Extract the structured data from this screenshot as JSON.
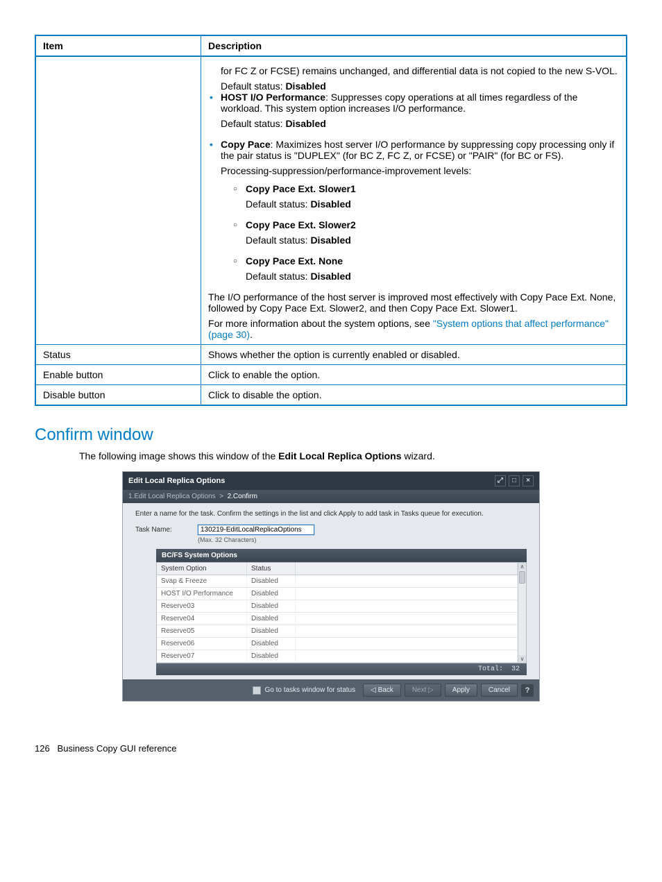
{
  "table": {
    "header_item": "Item",
    "header_desc": "Description",
    "row0": {
      "frag_a": "for FC Z or FCSE) remains unchanged, and differential data is not copied to the new S-VOL.",
      "frag_b_pre": "Default status: ",
      "frag_b_bold": "Disabled",
      "hostio_bold": "HOST I/O Performance",
      "hostio_rest": ": Suppresses copy operations at all times regardless of the workload. This system option increases I/O performance.",
      "hostio_def_pre": "Default status: ",
      "hostio_def_bold": "Disabled",
      "copypace_bold": "Copy Pace",
      "copypace_rest": ": Maximizes host server I/O performance by suppressing copy processing only if the pair status is \"DUPLEX\" (for BC Z, FC Z, or FCSE) or \"PAIR\" (for BC or FS).",
      "copypace_levels": "Processing-suppression/performance-improvement levels:",
      "lvl1_bold": "Copy Pace Ext. Slower1",
      "lvl1_def_pre": "Default status: ",
      "lvl1_def_bold": "Disabled",
      "lvl2_bold": "Copy Pace Ext. Slower2",
      "lvl2_def_pre": "Default status: ",
      "lvl2_def_bold": "Disabled",
      "lvl3_bold": "Copy Pace Ext. None",
      "lvl3_def_pre": "Default status: ",
      "lvl3_def_bold": "Disabled",
      "perf_note": "The I/O performance of the host server is improved most effectively with Copy Pace Ext. None, followed by Copy Pace Ext. Slower2, and then Copy Pace Ext. Slower1.",
      "more_pre": "For more information about the system options, see ",
      "more_link": "\"System options that affect performance\" (page 30)",
      "more_post": "."
    },
    "row_status_item": "Status",
    "row_status_desc": "Shows whether the option is currently enabled or disabled.",
    "row_enable_item": "Enable button",
    "row_enable_desc": "Click to enable the option.",
    "row_disable_item": "Disable button",
    "row_disable_desc": "Click to disable the option."
  },
  "section_title": "Confirm window",
  "intro_pre": "The following image shows this window of the ",
  "intro_bold": "Edit Local Replica Options",
  "intro_post": " wizard.",
  "wizard": {
    "title": "Edit Local Replica Options",
    "bc_step1": "1.Edit Local Replica Options",
    "bc_sep": ">",
    "bc_step2": "2.Confirm",
    "instruction": "Enter a name for the task. Confirm the settings in the list and click Apply to add task in Tasks queue for execution.",
    "task_label": "Task Name:",
    "task_value": "130219-EditLocalReplicaOptions",
    "task_hint": "(Max. 32 Characters)",
    "panel_title": "BC/FS System Options",
    "col_option": "System Option",
    "col_status": "Status",
    "rows": [
      {
        "opt": "Svap & Freeze",
        "status": "Disabled"
      },
      {
        "opt": "HOST I/O Performance",
        "status": "Disabled"
      },
      {
        "opt": "Reserve03",
        "status": "Disabled"
      },
      {
        "opt": "Reserve04",
        "status": "Disabled"
      },
      {
        "opt": "Reserve05",
        "status": "Disabled"
      },
      {
        "opt": "Reserve06",
        "status": "Disabled"
      },
      {
        "opt": "Reserve07",
        "status": "Disabled"
      }
    ],
    "total_label": "Total:",
    "total_value": "32",
    "footer_check": "Go to tasks window for status",
    "btn_back": "◁ Back",
    "btn_next": "Next ▷",
    "btn_apply": "Apply",
    "btn_cancel": "Cancel"
  },
  "footer_page": "126",
  "footer_text": "Business Copy GUI reference"
}
